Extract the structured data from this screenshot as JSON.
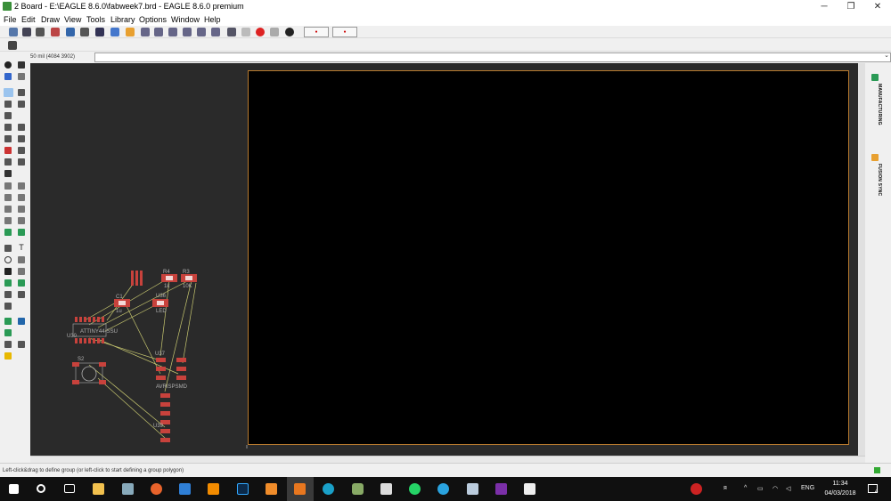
{
  "window": {
    "title": "2 Board - E:\\EAGLE 8.6.0\\fabweek7.brd - EAGLE 8.6.0 premium",
    "minimize": "─",
    "maximize": "❐",
    "close": "✕"
  },
  "menu": [
    "File",
    "Edit",
    "Draw",
    "View",
    "Tools",
    "Library",
    "Options",
    "Window",
    "Help"
  ],
  "coord": {
    "readout": "50 mil (4084 3902)"
  },
  "right_panel": {
    "manufacturing": "MANUFACTURING",
    "fusion_sync": "FUSION SYNC"
  },
  "status": {
    "message": "Left-click&drag to define group (or left-click to start defining a group polygon)"
  },
  "board": {
    "labels": {
      "r4": "R4",
      "r3": "R3",
      "r4b": "1k",
      "r3b": "10K",
      "c2": "C1",
      "c2b": "1u",
      "led_ref": "U36",
      "led_val": "LED",
      "ic_ref": "U30",
      "ic_val": "ATTINY44-SSU",
      "sw_ref": "S2",
      "isp_ref": "U37",
      "isp_val": "AVRISPSMD",
      "hdr_ref": "U39"
    }
  },
  "taskbar": {
    "clock_time": "11:34",
    "clock_date": "04/03/2018",
    "lang": "ENG",
    "notif_count": "4"
  },
  "colors": {
    "board_bg": "#000000",
    "canvas_bg": "#2a2a2a",
    "board_outline": "#b77a2e",
    "pad": "#c8423c",
    "airwire": "#c8c870",
    "silk": "#b0b0b0"
  }
}
